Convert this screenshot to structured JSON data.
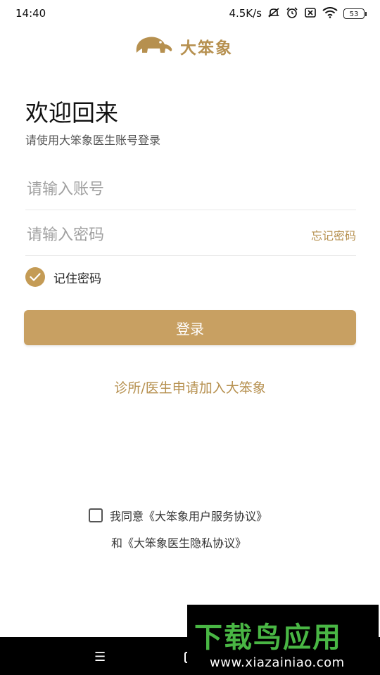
{
  "status": {
    "time": "14:40",
    "net_speed": "4.5K/s",
    "battery": "53"
  },
  "app": {
    "logo_text": "大笨象"
  },
  "login": {
    "title": "欢迎回来",
    "subtitle": "请使用大笨象医生账号登录",
    "account_placeholder": "请输入账号",
    "account_value": "",
    "password_placeholder": "请输入密码",
    "password_value": "",
    "forgot_label": "忘记密码",
    "remember_label": "记住密码",
    "remember_checked": true,
    "login_button": "登录",
    "join_link": "诊所/医生申请加入大笨象"
  },
  "agreement": {
    "prefix": "我同意",
    "user_agreement": "《大笨象用户服务协议》",
    "connector": "和",
    "privacy_policy": "《大笨象医生隐私协议》",
    "checked": false
  },
  "nav": {
    "menu_glyph": "☰"
  },
  "watermark": {
    "title": "下载鸟应用",
    "url": "www.xiazainiao.com"
  },
  "colors": {
    "accent": "#c8a062",
    "accent_text": "#b6904f",
    "watermark_green": "#49b644"
  }
}
